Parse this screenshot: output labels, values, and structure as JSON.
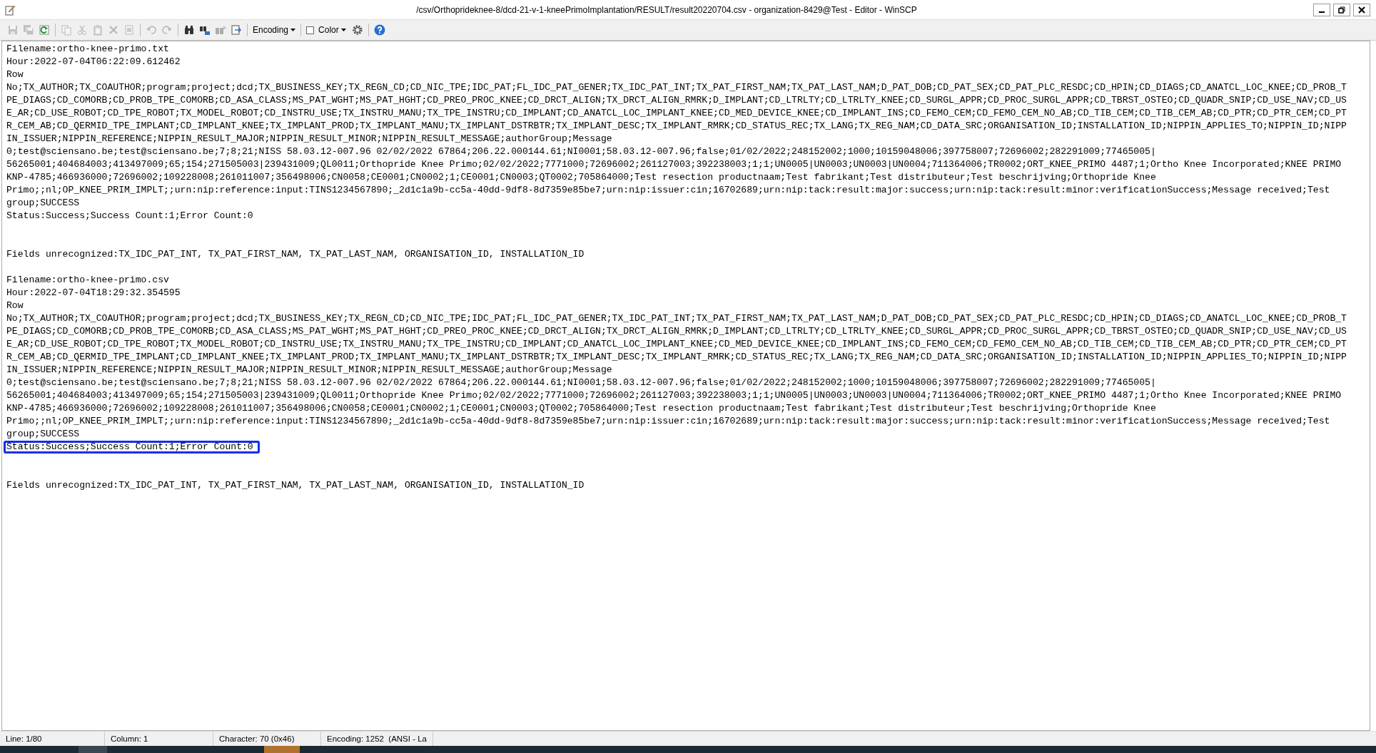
{
  "window": {
    "title": "/csv/Orthoprideknee-8/dcd-21-v-1-kneePrimoImplantation/RESULT/result20220704.csv - organization-8429@Test - Editor - WinSCP"
  },
  "toolbar": {
    "buttons": [
      {
        "disabled": true
      },
      {
        "disabled": true
      },
      {
        "disabled": false
      },
      {
        "disabled": true
      },
      {
        "disabled": true
      },
      {
        "disabled": true
      },
      {
        "disabled": true
      },
      {
        "disabled": true
      },
      {
        "disabled": true
      },
      {
        "disabled": true
      },
      {
        "disabled": false
      },
      {
        "disabled": false
      },
      {
        "disabled": true
      },
      {
        "disabled": false
      }
    ],
    "encoding_menu": {
      "label": "Encoding"
    },
    "color_option": {
      "label": "Color",
      "checked": false
    }
  },
  "editor": {
    "lines": [
      {
        "kind": "text",
        "highlighted": false,
        "text": "Filename:ortho-knee-primo.txt"
      },
      {
        "kind": "text",
        "highlighted": false,
        "text": "Hour:2022-07-04T06:22:09.612462"
      },
      {
        "kind": "text",
        "highlighted": false,
        "text": "Row"
      },
      {
        "kind": "text",
        "highlighted": false,
        "text": "No;TX_AUTHOR;TX_COAUTHOR;program;project;dcd;TX_BUSINESS_KEY;TX_REGN_CD;CD_NIC_TPE;IDC_PAT;FL_IDC_PAT_GENER;TX_IDC_PAT_INT;TX_PAT_FIRST_NAM;TX_PAT_LAST_NAM;D_PAT_DOB;CD_PAT_SEX;CD_PAT_PLC_RESDC;CD_HPIN;CD_DIAGS;CD_ANATCL_LOC_KNEE;CD_PROB_T"
      },
      {
        "kind": "text",
        "highlighted": false,
        "text": "PE_DIAGS;CD_COMORB;CD_PROB_TPE_COMORB;CD_ASA_CLASS;MS_PAT_WGHT;MS_PAT_HGHT;CD_PREO_PROC_KNEE;CD_DRCT_ALIGN;TX_DRCT_ALIGN_RMRK;D_IMPLANT;CD_LTRLTY;CD_LTRLTY_KNEE;CD_SURGL_APPR;CD_PROC_SURGL_APPR;CD_TBRST_OSTEO;CD_QUADR_SNIP;CD_USE_NAV;CD_US"
      },
      {
        "kind": "text",
        "highlighted": false,
        "text": "E_AR;CD_USE_ROBOT;CD_TPE_ROBOT;TX_MODEL_ROBOT;CD_INSTRU_USE;TX_INSTRU_MANU;TX_TPE_INSTRU;CD_IMPLANT;CD_ANATCL_LOC_IMPLANT_KNEE;CD_MED_DEVICE_KNEE;CD_IMPLANT_INS;CD_FEMO_CEM;CD_FEMO_CEM_NO_AB;CD_TIB_CEM;CD_TIB_CEM_AB;CD_PTR;CD_PTR_CEM;CD_PT"
      },
      {
        "kind": "text",
        "highlighted": false,
        "text": "R_CEM_AB;CD_QERMID_TPE_IMPLANT;CD_IMPLANT_KNEE;TX_IMPLANT_PROD;TX_IMPLANT_MANU;TX_IMPLANT_DSTRBTR;TX_IMPLANT_DESC;TX_IMPLANT_RMRK;CD_STATUS_REC;TX_LANG;TX_REG_NAM;CD_DATA_SRC;ORGANISATION_ID;INSTALLATION_ID;NIPPIN_APPLIES_TO;NIPPIN_ID;NIPP"
      },
      {
        "kind": "text",
        "highlighted": false,
        "text": "IN_ISSUER;NIPPIN_REFERENCE;NIPPIN_RESULT_MAJOR;NIPPIN_RESULT_MINOR;NIPPIN_RESULT_MESSAGE;authorGroup;Message"
      },
      {
        "kind": "text",
        "highlighted": false,
        "text": "0;test@sciensano.be;test@sciensano.be;7;8;21;NISS 58.03.12-007.96 02/02/2022 67864;206.22.000144.61;NI0001;58.03.12-007.96;false;01/02/2022;248152002;1000;10159048006;397758007;72696002;282291009;77465005|"
      },
      {
        "kind": "text",
        "highlighted": false,
        "text": "56265001;404684003;413497009;65;154;271505003|239431009;QL0011;Orthopride Knee Primo;02/02/2022;7771000;72696002;261127003;392238003;1;1;UN0005|UN0003;UN0003|UN0004;711364006;TR0002;ORT_KNEE_PRIMO 4487;1;Ortho Knee Incorporated;KNEE PRIMO"
      },
      {
        "kind": "text",
        "highlighted": false,
        "text": "KNP-4785;466936000;72696002;109228008;261011007;356498006;CN0058;CE0001;CN0002;1;CE0001;CN0003;QT0002;705864000;Test resection productnaam;Test fabrikant;Test distributeur;Test beschrijving;Orthopride Knee"
      },
      {
        "kind": "text",
        "highlighted": false,
        "text": "Primo;;nl;OP_KNEE_PRIM_IMPLT;;urn:nip:reference:input:TINS1234567890;_2d1c1a9b-cc5a-40dd-9df8-8d7359e85be7;urn:nip:issuer:cin;16702689;urn:nip:tack:result:major:success;urn:nip:tack:result:minor:verificationSuccess;Message received;Test"
      },
      {
        "kind": "text",
        "highlighted": false,
        "text": "group;SUCCESS"
      },
      {
        "kind": "text",
        "highlighted": false,
        "text": "Status:Success;Success Count:1;Error Count:0"
      },
      {
        "kind": "blank"
      },
      {
        "kind": "blank"
      },
      {
        "kind": "text",
        "highlighted": false,
        "text": "Fields unrecognized:TX_IDC_PAT_INT, TX_PAT_FIRST_NAM, TX_PAT_LAST_NAM, ORGANISATION_ID, INSTALLATION_ID"
      },
      {
        "kind": "blank"
      },
      {
        "kind": "text",
        "highlighted": false,
        "text": "Filename:ortho-knee-primo.csv"
      },
      {
        "kind": "text",
        "highlighted": false,
        "text": "Hour:2022-07-04T18:29:32.354595"
      },
      {
        "kind": "text",
        "highlighted": false,
        "text": "Row"
      },
      {
        "kind": "text",
        "highlighted": false,
        "text": "No;TX_AUTHOR;TX_COAUTHOR;program;project;dcd;TX_BUSINESS_KEY;TX_REGN_CD;CD_NIC_TPE;IDC_PAT;FL_IDC_PAT_GENER;TX_IDC_PAT_INT;TX_PAT_FIRST_NAM;TX_PAT_LAST_NAM;D_PAT_DOB;CD_PAT_SEX;CD_PAT_PLC_RESDC;CD_HPIN;CD_DIAGS;CD_ANATCL_LOC_KNEE;CD_PROB_T"
      },
      {
        "kind": "text",
        "highlighted": false,
        "text": "PE_DIAGS;CD_COMORB;CD_PROB_TPE_COMORB;CD_ASA_CLASS;MS_PAT_WGHT;MS_PAT_HGHT;CD_PREO_PROC_KNEE;CD_DRCT_ALIGN;TX_DRCT_ALIGN_RMRK;D_IMPLANT;CD_LTRLTY;CD_LTRLTY_KNEE;CD_SURGL_APPR;CD_PROC_SURGL_APPR;CD_TBRST_OSTEO;CD_QUADR_SNIP;CD_USE_NAV;CD_US"
      },
      {
        "kind": "text",
        "highlighted": false,
        "text": "E_AR;CD_USE_ROBOT;CD_TPE_ROBOT;TX_MODEL_ROBOT;CD_INSTRU_USE;TX_INSTRU_MANU;TX_TPE_INSTRU;CD_IMPLANT;CD_ANATCL_LOC_IMPLANT_KNEE;CD_MED_DEVICE_KNEE;CD_IMPLANT_INS;CD_FEMO_CEM;CD_FEMO_CEM_NO_AB;CD_TIB_CEM;CD_TIB_CEM_AB;CD_PTR;CD_PTR_CEM;CD_PT"
      },
      {
        "kind": "text",
        "highlighted": false,
        "text": "R_CEM_AB;CD_QERMID_TPE_IMPLANT;CD_IMPLANT_KNEE;TX_IMPLANT_PROD;TX_IMPLANT_MANU;TX_IMPLANT_DSTRBTR;TX_IMPLANT_DESC;TX_IMPLANT_RMRK;CD_STATUS_REC;TX_LANG;TX_REG_NAM;CD_DATA_SRC;ORGANISATION_ID;INSTALLATION_ID;NIPPIN_APPLIES_TO;NIPPIN_ID;NIPP"
      },
      {
        "kind": "text",
        "highlighted": false,
        "text": "IN_ISSUER;NIPPIN_REFERENCE;NIPPIN_RESULT_MAJOR;NIPPIN_RESULT_MINOR;NIPPIN_RESULT_MESSAGE;authorGroup;Message"
      },
      {
        "kind": "text",
        "highlighted": false,
        "text": "0;test@sciensano.be;test@sciensano.be;7;8;21;NISS 58.03.12-007.96 02/02/2022 67864;206.22.000144.61;NI0001;58.03.12-007.96;false;01/02/2022;248152002;1000;10159048006;397758007;72696002;282291009;77465005|"
      },
      {
        "kind": "text",
        "highlighted": false,
        "text": "56265001;404684003;413497009;65;154;271505003|239431009;QL0011;Orthopride Knee Primo;02/02/2022;7771000;72696002;261127003;392238003;1;1;UN0005|UN0003;UN0003|UN0004;711364006;TR0002;ORT_KNEE_PRIMO 4487;1;Ortho Knee Incorporated;KNEE PRIMO"
      },
      {
        "kind": "text",
        "highlighted": false,
        "text": "KNP-4785;466936000;72696002;109228008;261011007;356498006;CN0058;CE0001;CN0002;1;CE0001;CN0003;QT0002;705864000;Test resection productnaam;Test fabrikant;Test distributeur;Test beschrijving;Orthopride Knee"
      },
      {
        "kind": "text",
        "highlighted": false,
        "text": "Primo;;nl;OP_KNEE_PRIM_IMPLT;;urn:nip:reference:input:TINS1234567890;_2d1c1a9b-cc5a-40dd-9df8-8d7359e85be7;urn:nip:issuer:cin;16702689;urn:nip:tack:result:major:success;urn:nip:tack:result:minor:verificationSuccess;Message received;Test"
      },
      {
        "kind": "text",
        "highlighted": false,
        "text": "group;SUCCESS"
      },
      {
        "kind": "text",
        "highlighted": true,
        "text": "Status:Success;Success Count:1;Error Count:0"
      },
      {
        "kind": "blank"
      },
      {
        "kind": "blank"
      },
      {
        "kind": "text",
        "highlighted": false,
        "text": "Fields unrecognized:TX_IDC_PAT_INT, TX_PAT_FIRST_NAM, TX_PAT_LAST_NAM, ORGANISATION_ID, INSTALLATION_ID"
      }
    ]
  },
  "status_bar": [
    "Line: 1/80",
    "Column: 1",
    "Character: 70 (0x46)",
    "Encoding: 1252  (ANSI - La"
  ]
}
